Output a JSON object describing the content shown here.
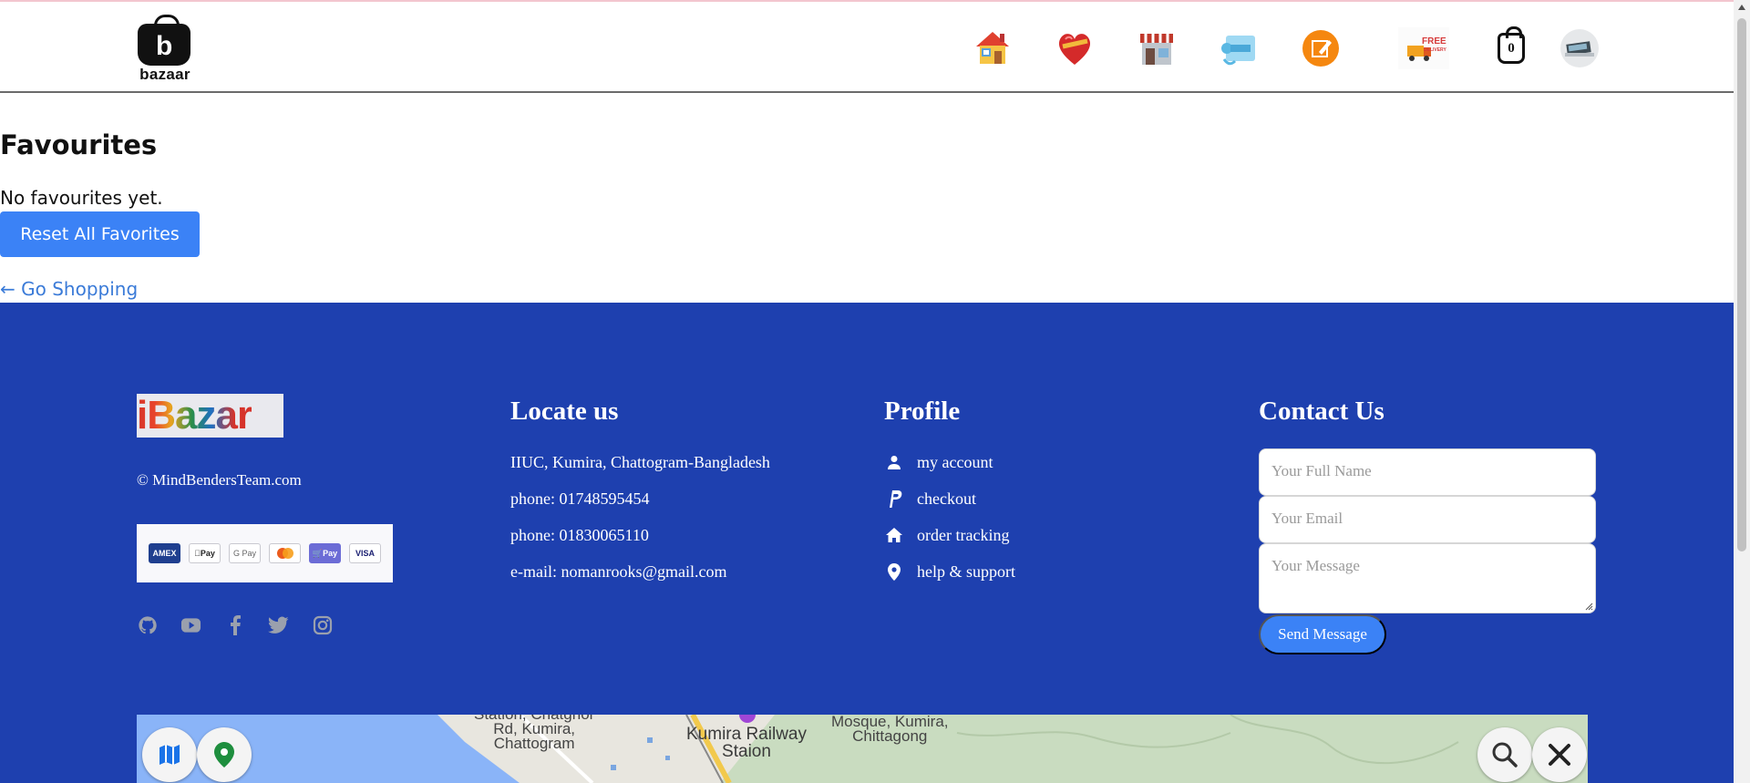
{
  "header": {
    "logo_text": "bazaar",
    "logo_letter": "b",
    "nav": [
      {
        "name": "home",
        "icon": "house-icon"
      },
      {
        "name": "favourites",
        "icon": "heart-icon"
      },
      {
        "name": "shop",
        "icon": "storefront-icon"
      },
      {
        "name": "contact",
        "icon": "contact-scroll-icon"
      },
      {
        "name": "blog",
        "icon": "edit-badge-icon"
      },
      {
        "name": "delivery",
        "icon": "free-delivery-truck-icon"
      },
      {
        "name": "cart",
        "icon": "shopping-bag-icon"
      },
      {
        "name": "profile",
        "icon": "avatar-laptop-icon"
      }
    ],
    "cart_count": "0",
    "delivery_label_1": "FREE",
    "delivery_label_2": "DELIVERY"
  },
  "main": {
    "title": "Favourites",
    "empty_message": "No favourites yet.",
    "reset_button": "Reset All Favorites",
    "go_shopping": "← Go Shopping"
  },
  "footer": {
    "brand": "iBazar",
    "copyright": "© MindBendersTeam.com",
    "payments": [
      "AMEX",
      "Pay",
      "G Pay",
      "",
      "Pay",
      "VISA"
    ],
    "socials": [
      "github-icon",
      "youtube-icon",
      "facebook-icon",
      "twitter-icon",
      "instagram-icon"
    ],
    "locate": {
      "title": "Locate us",
      "address": "IIUC, Kumira, Chattogram-Bangladesh",
      "phone1": "phone: 01748595454",
      "phone2": "phone: 01830065110",
      "email": "e-mail: nomanrooks@gmail.com"
    },
    "profile": {
      "title": "Profile",
      "items": [
        "my account",
        "checkout",
        "order tracking",
        "help & support"
      ]
    },
    "contact": {
      "title": "Contact Us",
      "name_placeholder": "Your Full Name",
      "email_placeholder": "Your Email",
      "message_placeholder": "Your Message",
      "send": "Send Message"
    },
    "map": {
      "label1_a": "Station, Chatghor",
      "label1_b": "Rd, Kumira,",
      "label1_c": "Chattogram",
      "label2_a": "Kumira Railway",
      "label2_b": "Staion",
      "label3_a": "Mosque, Kumira,",
      "label3_b": "Chittagong"
    }
  },
  "colors": {
    "accent": "#3b82f6",
    "footer_bg": "#1e40af",
    "link": "#3b7bd8"
  }
}
